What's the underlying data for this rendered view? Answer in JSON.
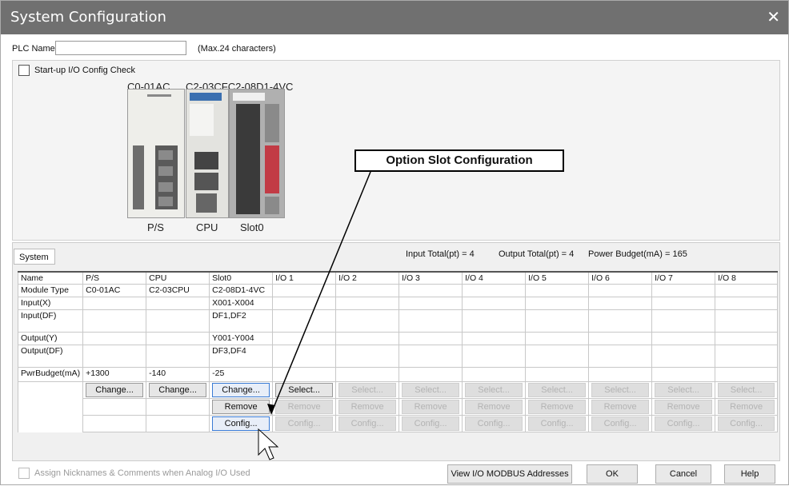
{
  "window": {
    "title": "System Configuration",
    "close": "✕"
  },
  "plc_name": {
    "label": "PLC Name",
    "value": "",
    "hint": "(Max.24 characters)"
  },
  "startup_check": {
    "label": "Start-up I/O Config Check"
  },
  "rack": {
    "module_names": [
      "C0-01AC",
      "C2-03CFC2-08D1-4VC"
    ],
    "slot_labels": [
      "P/S",
      "CPU",
      "Slot0"
    ]
  },
  "callout": "Option Slot Configuration",
  "system_tab": "System",
  "totals": {
    "input": "Input Total(pt) = 4",
    "output": "Output Total(pt) = 4",
    "power": "Power Budget(mA) = 165"
  },
  "grid": {
    "headers": [
      "Name",
      "P/S",
      "CPU",
      "Slot0",
      "I/O 1",
      "I/O 2",
      "I/O 3",
      "I/O 4",
      "I/O 5",
      "I/O 6",
      "I/O 7",
      "I/O 8"
    ],
    "rows": [
      [
        "Module Type",
        "C0-01AC",
        "C2-03CPU",
        "C2-08D1-4VC",
        "",
        "",
        "",
        "",
        "",
        "",
        "",
        ""
      ],
      [
        "Input(X)",
        "",
        "",
        "X001-X004",
        "",
        "",
        "",
        "",
        "",
        "",
        "",
        ""
      ],
      [
        "Input(DF)",
        "",
        "",
        "DF1,DF2",
        "",
        "",
        "",
        "",
        "",
        "",
        "",
        ""
      ],
      [
        "Output(Y)",
        "",
        "",
        "Y001-Y004",
        "",
        "",
        "",
        "",
        "",
        "",
        "",
        ""
      ],
      [
        "Output(DF)",
        "",
        "",
        "DF3,DF4",
        "",
        "",
        "",
        "",
        "",
        "",
        "",
        ""
      ],
      [
        "PwrBudget(mA)",
        "+1300",
        "-140",
        "-25",
        "",
        "",
        "",
        "",
        "",
        "",
        "",
        ""
      ]
    ],
    "change_label": "Change...",
    "select_label": "Select...",
    "remove_label": "Remove",
    "config_label": "Config..."
  },
  "bottom": {
    "assign_label": "Assign Nicknames & Comments when Analog I/O Used",
    "modbus": "View I/O MODBUS Addresses",
    "ok": "OK",
    "cancel": "Cancel",
    "help": "Help"
  }
}
